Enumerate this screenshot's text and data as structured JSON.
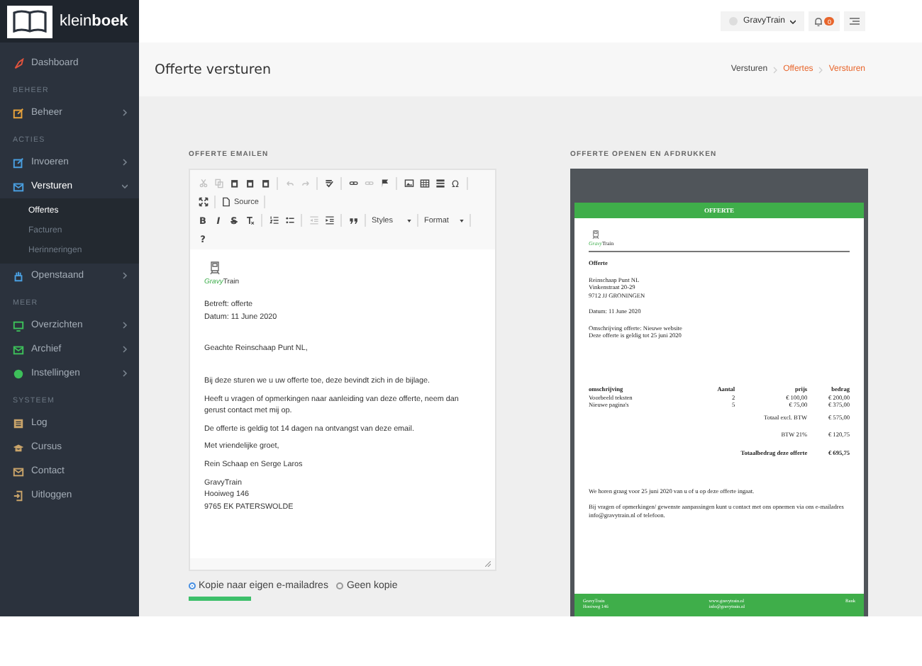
{
  "topbar": {
    "logo": "klein**boek**",
    "user": "GravyTrain",
    "notifications": "0"
  },
  "sidebar": {
    "sections": [
      {
        "items": [
          {
            "label": "Dashboard",
            "kind": "rocket",
            "color": "#e0533d",
            "expandable": false
          }
        ]
      },
      {
        "title": "BEHEER",
        "items": [
          {
            "label": "Beheer",
            "kind": "edit",
            "color": "#e8a33c",
            "expandable": true,
            "expanded": false
          }
        ]
      },
      {
        "title": "ACTIES",
        "items": [
          {
            "label": "Invoeren",
            "kind": "edit",
            "color": "#4a9fe0",
            "expandable": true,
            "expanded": false
          },
          {
            "label": "Versturen",
            "kind": "mail",
            "color": "#4a9fe0",
            "expandable": true,
            "expanded": true,
            "children": [
              {
                "label": "Offertes",
                "selected": true
              },
              {
                "label": "Facturen",
                "selected": false
              },
              {
                "label": "Herinneringen",
                "selected": false
              }
            ]
          },
          {
            "label": "Openstaand",
            "kind": "hand",
            "color": "#4a9fe0",
            "expandable": true,
            "expanded": false
          }
        ]
      },
      {
        "title": "MEER",
        "items": [
          {
            "label": "Overzichten",
            "kind": "monitor",
            "color": "#3dbf5a",
            "expandable": true,
            "expanded": false
          },
          {
            "label": "Archief",
            "kind": "mail",
            "color": "#3dbf5a",
            "expandable": true,
            "expanded": false
          },
          {
            "label": "Instellingen",
            "kind": "gear",
            "color": "#3dbf5a",
            "expandable": true,
            "expanded": false
          }
        ]
      },
      {
        "title": "SYSTEEM",
        "items": [
          {
            "label": "Log",
            "kind": "list",
            "color": "#c9a46a",
            "expandable": false
          },
          {
            "label": "Cursus",
            "kind": "cap",
            "color": "#c9a46a",
            "expandable": false
          },
          {
            "label": "Contact",
            "kind": "mail",
            "color": "#c9a46a",
            "expandable": false
          },
          {
            "label": "Uitloggen",
            "kind": "logout",
            "color": "#c9a46a",
            "expandable": false
          }
        ]
      }
    ]
  },
  "page": {
    "title": "Offerte versturen",
    "breadcrumb": [
      {
        "label": "Versturen",
        "link": false
      },
      {
        "label": "Offertes",
        "link": true
      },
      {
        "label": "Versturen",
        "link": true
      }
    ]
  },
  "email": {
    "heading": "OFFERTE EMAILEN",
    "toolbar": [
      [
        {
          "kind": "cut",
          "disabled": true
        },
        {
          "kind": "copy",
          "disabled": true
        },
        {
          "kind": "paste",
          "disabled": false
        },
        {
          "kind": "paste",
          "disabled": false
        },
        {
          "kind": "paste",
          "disabled": false
        },
        {
          "kind": "sep"
        },
        {
          "kind": "undo",
          "disabled": true
        },
        {
          "kind": "redo",
          "disabled": true
        },
        {
          "kind": "sep"
        },
        {
          "kind": "spellcheck",
          "disabled": false
        },
        {
          "kind": "sep"
        },
        {
          "kind": "link",
          "disabled": false
        },
        {
          "kind": "link",
          "disabled": true
        },
        {
          "kind": "flag",
          "disabled": false
        },
        {
          "kind": "sep"
        },
        {
          "kind": "image",
          "disabled": false
        },
        {
          "kind": "table",
          "disabled": false
        },
        {
          "kind": "line",
          "disabled": false
        },
        {
          "kind": "text",
          "label": "Ω",
          "disabled": false
        },
        {
          "kind": "sep"
        }
      ],
      [
        {
          "kind": "maximize",
          "disabled": false
        },
        {
          "kind": "sep"
        },
        {
          "kind": "source",
          "label": "Source",
          "disabled": false
        },
        {
          "kind": "sep"
        }
      ],
      [
        {
          "kind": "bold",
          "label": "B",
          "disabled": false
        },
        {
          "kind": "italic",
          "label": "I",
          "disabled": false
        },
        {
          "kind": "strike",
          "label": "S",
          "disabled": false
        },
        {
          "kind": "clear",
          "disabled": false
        },
        {
          "kind": "sep"
        },
        {
          "kind": "olist",
          "disabled": false
        },
        {
          "kind": "ulist",
          "disabled": false
        },
        {
          "kind": "sep"
        },
        {
          "kind": "outdent",
          "disabled": true
        },
        {
          "kind": "indent",
          "disabled": false
        },
        {
          "kind": "sep"
        },
        {
          "kind": "quote",
          "disabled": false
        },
        {
          "kind": "sep"
        },
        {
          "kind": "dropdown",
          "label": "Styles",
          "disabled": false
        },
        {
          "kind": "sep"
        },
        {
          "kind": "dropdown",
          "label": "Format",
          "disabled": false
        },
        {
          "kind": "sep"
        }
      ],
      [
        {
          "kind": "bold",
          "label": "?",
          "disabled": false
        }
      ]
    ],
    "brand": {
      "first": "Gravy",
      "second": "Train"
    },
    "body": [
      {
        "kind": "meta",
        "lines": [
          "Betreft: offerte",
          "Datum: 11 June 2020"
        ]
      },
      {
        "kind": "salutation",
        "lines": [
          "Geachte Reinschaap Punt NL,"
        ]
      },
      {
        "kind": "p",
        "lines": [
          "Bij deze sturen we u uw offerte toe, deze bevindt zich in de bijlage."
        ]
      },
      {
        "kind": "p",
        "lines": [
          "Heeft u vragen of opmerkingen naar aanleiding van deze offerte, neem dan gerust contact met mij op."
        ]
      },
      {
        "kind": "p",
        "lines": [
          "De offerte is geldig tot 14 dagen na ontvangst van deze email."
        ]
      },
      {
        "kind": "p",
        "lines": [
          "Met vriendelijke groet,"
        ]
      },
      {
        "kind": "p",
        "lines": [
          "Rein Schaap en Serge Laros"
        ]
      },
      {
        "kind": "p",
        "lines": [
          "GravyTrain",
          "Hooiweg 146",
          "9765 EK PATERSWOLDE"
        ]
      }
    ],
    "copy_options": [
      {
        "label": "Kopie naar eigen e-mailadres",
        "selected": true
      },
      {
        "label": "Geen kopie",
        "selected": false
      }
    ]
  },
  "preview": {
    "heading": "OFFERTE OPENEN EN AFDRUKKEN",
    "title_bar": "OFFERTE",
    "brand": {
      "first": "Gravy",
      "second": "Train"
    },
    "doc_title": "Offerte",
    "address": [
      "Reinschaap Punt NL",
      "Vinkenstraat 20-29",
      "9712 JJ GRONINGEN"
    ],
    "date": "Datum: 11 June 2020",
    "subject": [
      "Omschrijving offerte: Nieuwe website",
      "Deze offerte is geldig tot 25 juni 2020"
    ],
    "columns": [
      "omschrijving",
      "Aantal",
      "prijs",
      "bedrag"
    ],
    "rows": [
      [
        "Voorbeeld teksten",
        "2",
        "€ 100,00",
        "€ 200,00"
      ],
      [
        "Nieuwe pagina's",
        "5",
        "€ 75,00",
        "€ 375,00"
      ]
    ],
    "totals": [
      {
        "label": "Totaal excl. BTW",
        "value": "€ 575,00",
        "bold": false
      },
      {
        "label": "BTW 21%",
        "value": "€ 120,75",
        "bold": false
      },
      {
        "label": "Totaalbedrag deze offerte",
        "value": "€ 695,75",
        "bold": true
      }
    ],
    "notes": [
      "We horen graag voor 25 juni 2020 van u of u op deze offerte ingaat.",
      "Bij vragen of opmerkingen/ gewenste aanpassingen kunt u contact met ons opnemen via ons e-mailadres info@gravytrain.nl of telefoon."
    ],
    "footer": [
      [
        "GravyTrain",
        "Hooiweg 146"
      ],
      [
        "www.gravytrain.nl",
        "info@gravytrain.nl"
      ],
      [
        "Bank"
      ]
    ]
  }
}
